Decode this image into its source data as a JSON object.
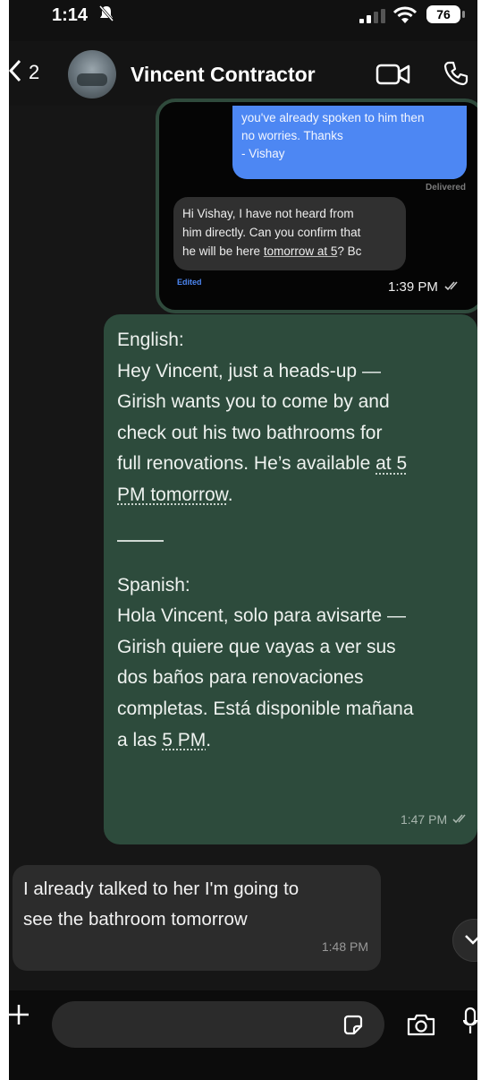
{
  "status_bar": {
    "time": "1:14",
    "battery": "76"
  },
  "header": {
    "back_count": "2",
    "contact_name": "Vincent Contractor"
  },
  "quoted": {
    "blue_lines": [
      "you've already spoken to him then",
      "no worries. Thanks",
      "- Vishay"
    ],
    "delivered": "Delivered",
    "gray_lines": [
      "Hi Vishay, I have not heard from",
      "him directly. Can you confirm that"
    ],
    "gray_line3_prefix": "he will be here ",
    "gray_line3_link": "tomorrow at 5",
    "gray_line3_suffix": "? Bc",
    "edited": "Edited",
    "time": "1:39 PM"
  },
  "translation": {
    "english_lines": [
      "English:",
      "Hey Vincent, just a heads-up —",
      "Girish wants you to come by and",
      "check out his two bathrooms for"
    ],
    "english_line5_prefix": "full renovations. He’s available ",
    "english_line5_link": "at 5",
    "english_line6_link": "PM tomorrow",
    "english_line6_suffix": ".",
    "spanish_lines": [
      "Spanish:",
      "Hola Vincent, solo para avisarte —",
      "Girish quiere que vayas a ver sus",
      "dos baños para renovaciones",
      "completas. Está disponible mañana"
    ],
    "spanish_line6_prefix": "a las ",
    "spanish_line6_link": "5 PM",
    "spanish_line6_suffix": ".",
    "time": "1:47 PM"
  },
  "incoming": {
    "lines": [
      "I already talked to her I'm going to",
      "see the bathroom tomorrow"
    ],
    "time": "1:48 PM"
  },
  "colors": {
    "sent_green": "#2d4b3c",
    "imessage_blue": "#4d87f3",
    "received_gray": "#2c2c2c"
  }
}
